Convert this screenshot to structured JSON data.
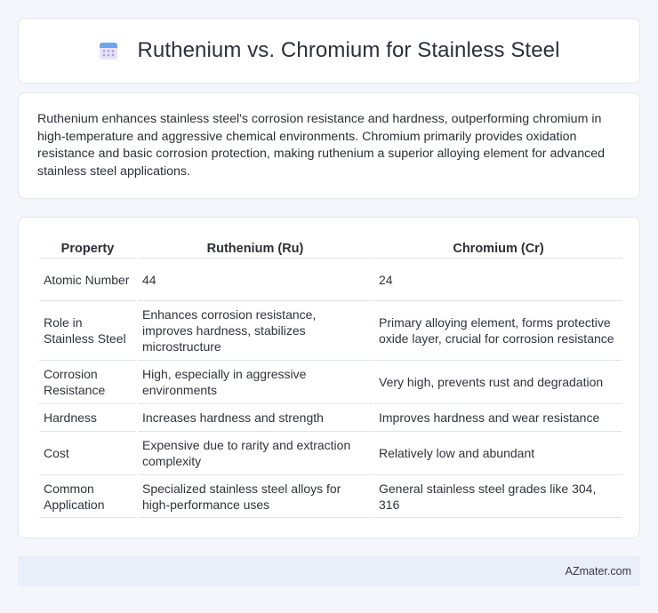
{
  "header": {
    "icon": "calendar-icon",
    "title": "Ruthenium vs. Chromium for Stainless Steel"
  },
  "summary": {
    "text": "Ruthenium enhances stainless steel's corrosion resistance and hardness, outperforming chromium in high-temperature and aggressive chemical environments. Chromium primarily provides oxidation resistance and basic corrosion protection, making ruthenium a superior alloying element for advanced stainless steel applications."
  },
  "table": {
    "columns": [
      "Property",
      "Ruthenium (Ru)",
      "Chromium (Cr)"
    ],
    "rows": [
      [
        "Atomic Number",
        "44",
        "24"
      ],
      [
        "Role in Stainless Steel",
        "Enhances corrosion resistance, improves hardness, stabilizes microstructure",
        "Primary alloying element, forms protective oxide layer, crucial for corrosion resistance"
      ],
      [
        "Corrosion Resistance",
        "High, especially in aggressive environments",
        "Very high, prevents rust and degradation"
      ],
      [
        "Hardness",
        "Increases hardness and strength",
        "Improves hardness and wear resistance"
      ],
      [
        "Cost",
        "Expensive due to rarity and extraction complexity",
        "Relatively low and abundant"
      ],
      [
        "Common Application",
        "Specialized stainless steel alloys for high-performance uses",
        "General stainless steel grades like 304, 316"
      ]
    ]
  },
  "footer": {
    "brand": "AZmater.com"
  },
  "colors": {
    "page_bg": "#f4f6fb",
    "footer_bg": "#e9eef8"
  }
}
